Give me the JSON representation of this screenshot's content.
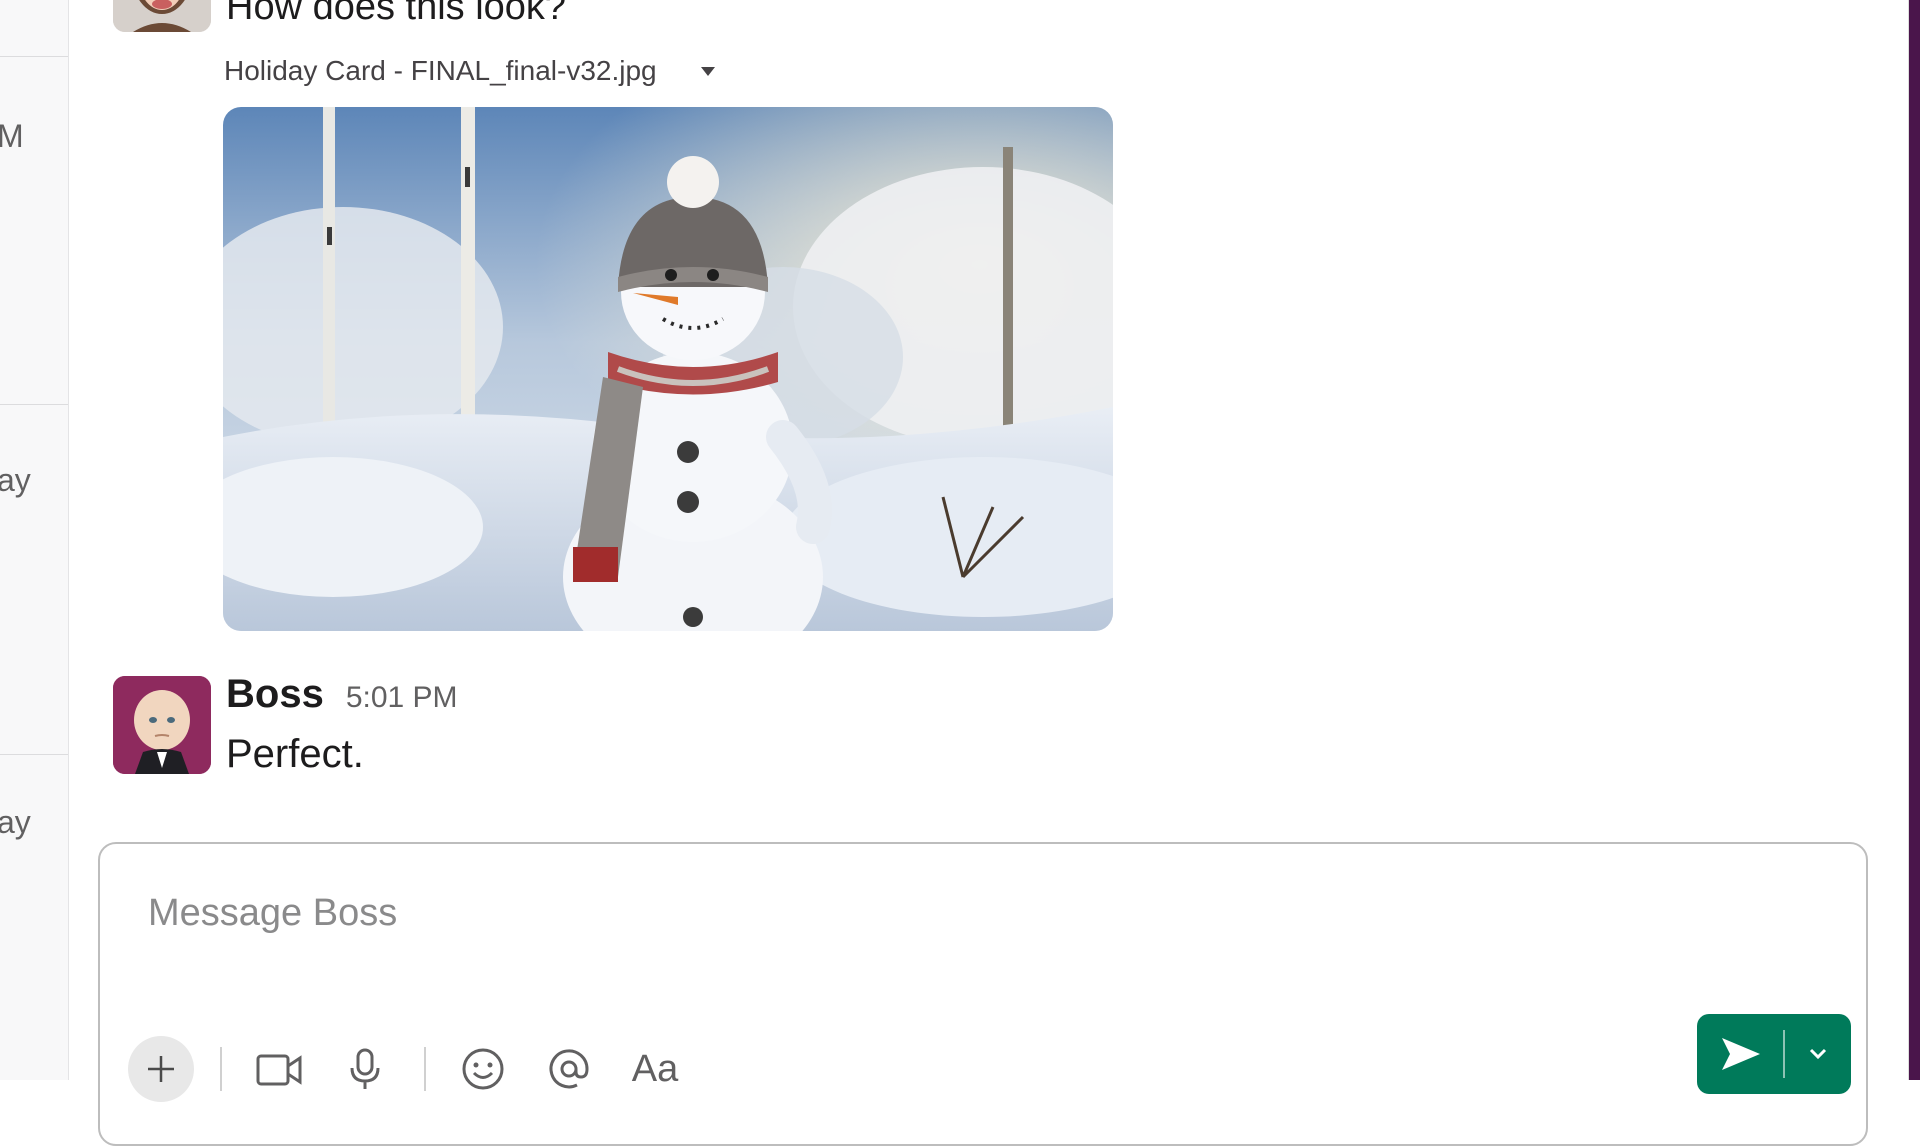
{
  "sidebar": {
    "fragments": [
      "M",
      "ay",
      "ay"
    ]
  },
  "messages": [
    {
      "text": "How does this look?",
      "attachment": {
        "file_name": "Holiday Card - FINAL_final-v32.jpg",
        "type": "image"
      }
    },
    {
      "sender": "Boss",
      "time": "5:01 PM",
      "text": "Perfect."
    }
  ],
  "composer": {
    "placeholder": "Message Boss",
    "tools": [
      "plus-icon",
      "video-icon",
      "microphone-icon",
      "emoji-icon",
      "mention-icon",
      "formatting-icon"
    ],
    "format_label": "Aa"
  },
  "colors": {
    "send_button": "#007a5a",
    "right_strip": "#4a154b",
    "boss_avatar_bg": "#8e2a5e"
  }
}
